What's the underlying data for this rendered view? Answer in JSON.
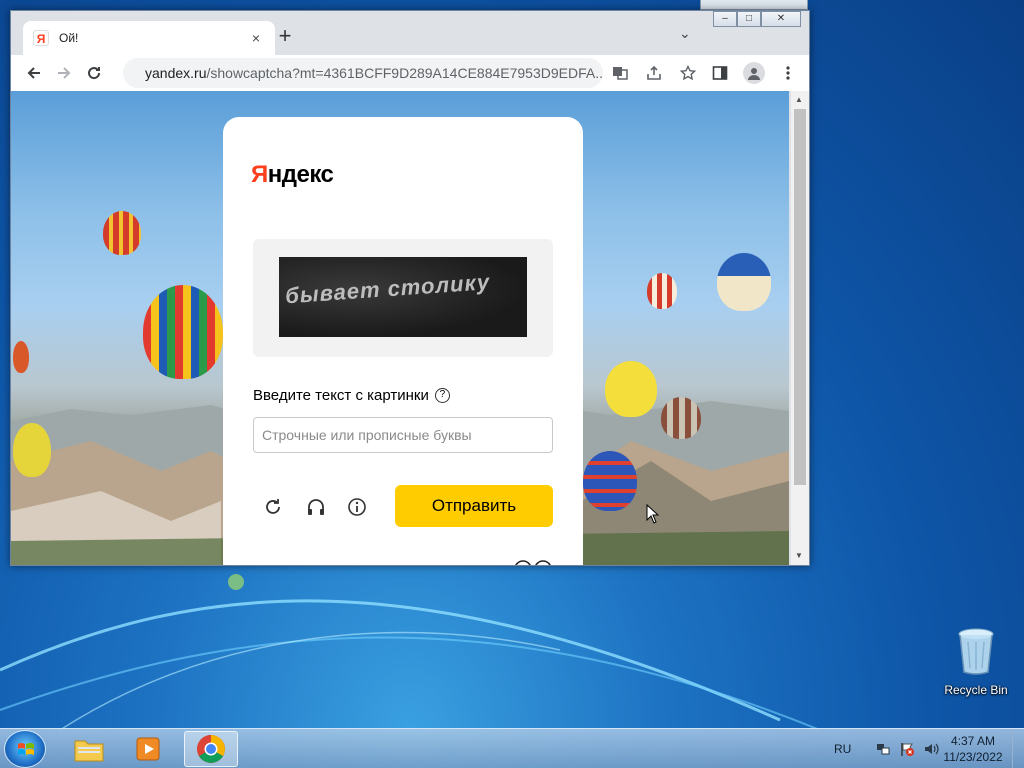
{
  "browser": {
    "tab_title": "Ой!",
    "tab_close": "×",
    "new_tab": "+",
    "tab_menu": "⌄",
    "url_host": "yandex.ru",
    "url_rest": "/showcaptcha?mt=4361BCFF9D289A14CE884E7953D9EDFA...",
    "window_controls": {
      "minimize": "–",
      "maximize": "□",
      "close": "✕"
    }
  },
  "page": {
    "logo_first": "Я",
    "logo_rest": "ндекс",
    "captcha_image_text": "бывает столику",
    "prompt_label": "Введите текст с картинки",
    "help_symbol": "?",
    "input_placeholder": "Строчные или прописные буквы",
    "input_value": "",
    "submit_label": "Отправить",
    "colors": {
      "submit_bg": "#ffcc00",
      "logo_red": "#fc3f1d"
    }
  },
  "desktop": {
    "recycle_bin_label": "Recycle Bin"
  },
  "taskbar": {
    "language": "RU",
    "time": "4:37 AM",
    "date": "11/23/2022",
    "apps": [
      "windows-explorer",
      "media-player",
      "chrome"
    ]
  }
}
